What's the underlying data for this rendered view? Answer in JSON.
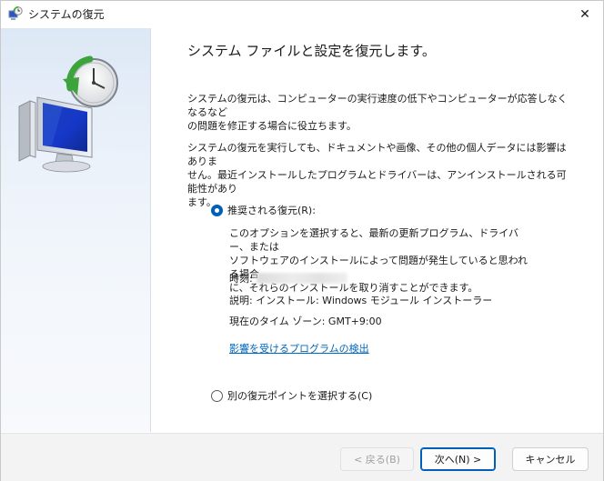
{
  "window": {
    "title": "システムの復元",
    "close_glyph": "✕"
  },
  "heading": "システム ファイルと設定を復元します。",
  "paragraphs": {
    "intro_lines": [
      "システムの復元は、コンピューターの実行速度の低下やコンピューターが応答しなくなるなど",
      "の問題を修正する場合に役立ちます。"
    ],
    "note_lines": [
      "システムの復元を実行しても、ドキュメントや画像、その他の個人データには影響はありま",
      "せん。最近インストールしたプログラムとドライバーは、アンインストールされる可能性があり",
      "ます。"
    ]
  },
  "options": {
    "recommended": {
      "label": "推奨される復元(R):",
      "checked": true,
      "description_lines": [
        "このオプションを選択すると、最新の更新プログラム、ドライバー、または",
        "ソフトウェアのインストールによって問題が発生していると思われる場合",
        "に、それらのインストールを取り消すことができます。"
      ],
      "time_label": "時刻:",
      "explanation": "説明: インストール: Windows モジュール インストーラー",
      "timezone": "現在のタイム ゾーン: GMT+9:00",
      "scan_link": "影響を受けるプログラムの検出"
    },
    "choose_other": {
      "label": "別の復元ポイントを選択する(C)",
      "checked": false
    }
  },
  "buttons": {
    "back": "< 戻る(B)",
    "next": "次へ(N) >",
    "cancel": "キャンセル"
  },
  "colors": {
    "accent": "#005fb8",
    "link": "#0067c0",
    "footer_bg": "#f3f3f3",
    "left_panel_bg": "#e6eef8"
  },
  "icons": {
    "title": "system-restore-icon",
    "hero": "restore-computer-clock-icon",
    "close": "close-icon"
  }
}
